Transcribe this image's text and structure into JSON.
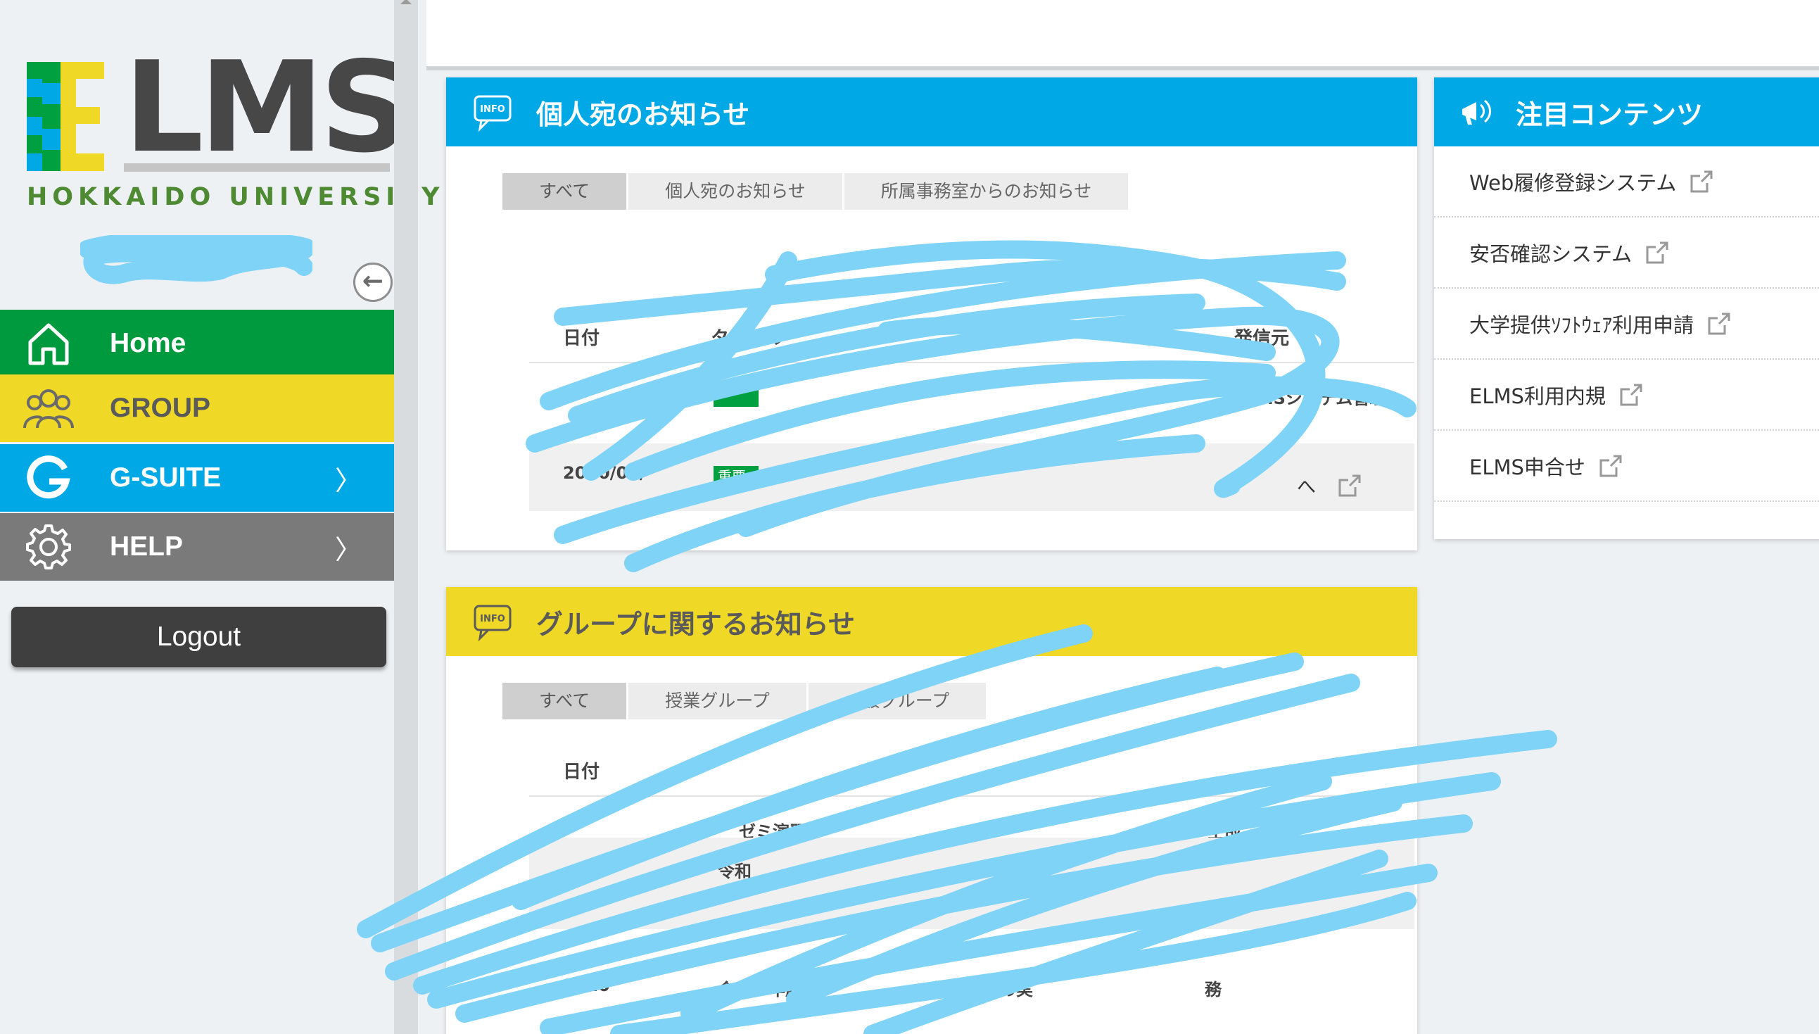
{
  "sidebar": {
    "logo_text": "ELMS",
    "university": "HOKKAIDO UNIVERSITY",
    "collapse_icon": "circle-arrow-left-icon",
    "nav": [
      {
        "label": "Home",
        "icon": "home-icon",
        "color": "#009a3e",
        "chevron": ""
      },
      {
        "label": "GROUP",
        "icon": "group-icon",
        "color": "#efd826",
        "chevron": ""
      },
      {
        "label": "G-SUITE",
        "icon": "google-g-icon",
        "color": "#00a9e6",
        "chevron": "〉"
      },
      {
        "label": "HELP",
        "icon": "gear-icon",
        "color": "#7a7a7a",
        "chevron": "〉"
      }
    ],
    "logout": "Logout"
  },
  "personal": {
    "title": "個人宛のお知らせ",
    "tabs": [
      "すべて",
      "個人宛のお知らせ",
      "所属事務室からのお知らせ"
    ],
    "columns": {
      "date": "日付",
      "title": "タイトル",
      "sender": "発信元"
    },
    "rows": [
      {
        "date": "",
        "badge": "",
        "sender": "ELMSシステム管理"
      },
      {
        "date": "2020/04/",
        "badge": "重要",
        "sender": ""
      }
    ],
    "more": "へ"
  },
  "group": {
    "title": "グループに関するお知らせ",
    "tabs": [
      "すべて",
      "授業グループ",
      "一般グループ"
    ],
    "columns": {
      "date": "日付"
    },
    "rows": [
      {
        "date": "",
        "title": "ゼミ演習",
        "sender": "主哉"
      },
      {
        "date": "",
        "title": "令和",
        "sender": ""
      },
      {
        "date": "2020",
        "title": "令和２年度第",
        "extra": "集中講義の実",
        "sender": "務"
      }
    ]
  },
  "featured": {
    "title": "注目コンテンツ",
    "icon": "megaphone-icon",
    "items": [
      "Web履修登録システム",
      "安否確認システム",
      "大学提供ｿﾌﾄｳｪｱ利用申請",
      "ELMS利用内規",
      "ELMS申合せ"
    ]
  },
  "colors": {
    "green": "#009a3e",
    "yellow": "#efd826",
    "blue": "#00a9e6",
    "gray": "#7a7a7a",
    "redaction": "#7fd3f7"
  }
}
